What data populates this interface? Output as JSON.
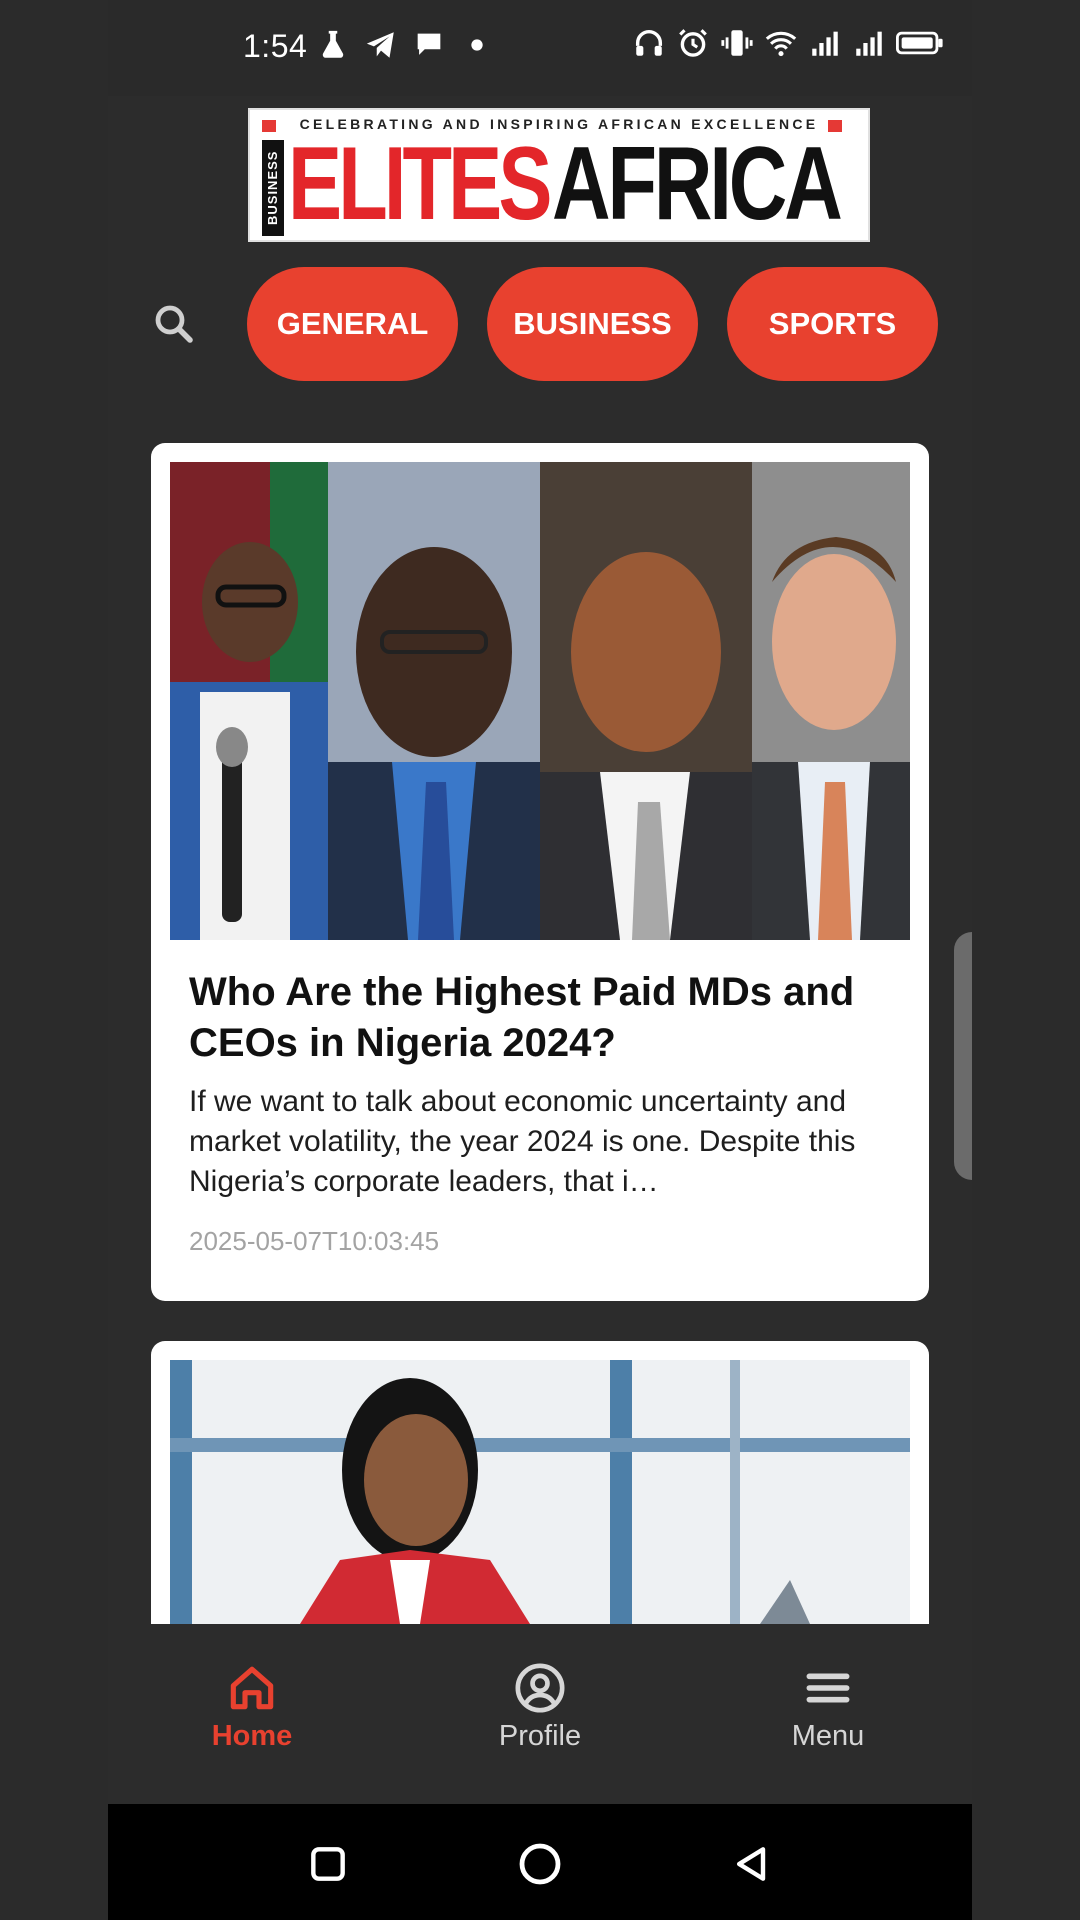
{
  "status_bar": {
    "time": "1:54",
    "icons_left": [
      "flask-icon",
      "telegram-icon",
      "chat-bubble-icon",
      "dot-icon"
    ],
    "icons_right": [
      "headphones-icon",
      "alarm-icon",
      "vibrate-icon",
      "wifi-icon",
      "signal-icon",
      "signal-icon",
      "battery-icon"
    ]
  },
  "logo": {
    "tagline": "CELEBRATING AND INSPIRING AFRICAN EXCELLENCE",
    "business": "BUSINESS",
    "elites": "ELITES",
    "africa": "AFRICA"
  },
  "categories": [
    {
      "label": "GENERAL"
    },
    {
      "label": "BUSINESS"
    },
    {
      "label": "SPORTS"
    }
  ],
  "articles": [
    {
      "title": "Who Are the Highest Paid MDs and CEOs in Nigeria 2024?",
      "excerpt": "If we want to talk about economic uncertainty and market volatility, the year 2024 is one. Despite this Nigeria’s corporate leaders, that i…",
      "date": "2025-05-07T10:03:45"
    }
  ],
  "bottom_nav": [
    {
      "label": "Home",
      "icon": "home-icon",
      "active": true
    },
    {
      "label": "Profile",
      "icon": "profile-icon",
      "active": false
    },
    {
      "label": "Menu",
      "icon": "menu-icon",
      "active": false
    }
  ],
  "colors": {
    "accent": "#e8412f",
    "background": "#2c2c2c",
    "card": "#ffffff",
    "date": "#a3a3a3",
    "nav_inactive": "#d6d6d6"
  }
}
